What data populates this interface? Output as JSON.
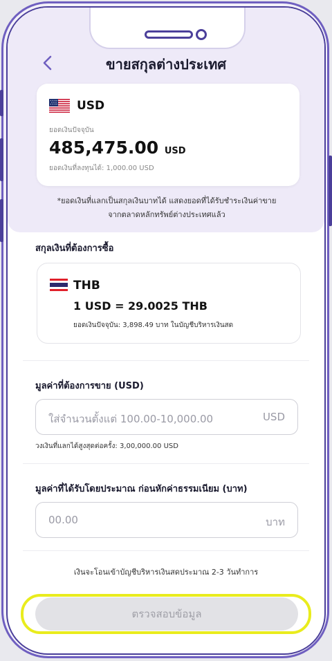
{
  "header": {
    "title": "ขายสกุลต่างประเทศ"
  },
  "source": {
    "currency_code": "USD",
    "balance_label": "ยอดเงินปัจจุบัน",
    "balance_amount": "485,475.00",
    "balance_unit": "USD",
    "investable_label": "ยอดเงินที่ลงทุนได้: 1,000.00 USD"
  },
  "note": {
    "line1": "*ยอดเงินที่แลกเป็นสกุลเงินบาทได้ แสดงยอดที่ได้รับชำระเงินค่าขาย",
    "line2": "จากตลาดหลักทรัพย์ต่างประเทศแล้ว"
  },
  "target": {
    "section_label": "สกุลเงินที่ต้องการซื้อ",
    "currency_code": "THB",
    "rate": "1 USD = 29.0025 THB",
    "balance_line": "ยอดเงินปัจจุบัน: 3,898.49 บาท ในบัญชีบริหารเงินสด"
  },
  "sell_amount": {
    "label": "มูลค่าที่ต้องการขาย (USD)",
    "placeholder": "ใส่จำนวนตั้งแต่ 100.00-10,000.00",
    "suffix": "USD",
    "hint": "วงเงินที่แลกได้สูงสุดต่อครั้ง: 3,00,000.00 USD"
  },
  "receive_amount": {
    "label": "มูลค่าที่ได้รับโดยประมาณ ก่อนหักค่าธรรมเนียม (บาท)",
    "placeholder": "00.00",
    "suffix": "บาท"
  },
  "transfer_note": "เงินจะโอนเข้าบัญชีบริหารเงินสดประมาณ 2-3 วันทำการ",
  "cta": {
    "label": "ตรวจสอบข้อมูล"
  },
  "colors": {
    "frame": "#4b3f9a",
    "header_bg": "#eeeaf8",
    "highlight": "#e9ec1d",
    "cta_bg": "#e2e2e6"
  }
}
